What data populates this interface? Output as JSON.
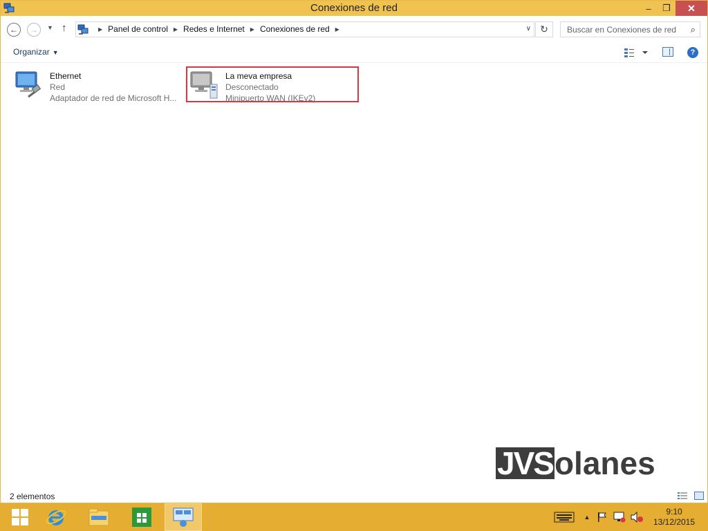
{
  "window": {
    "title": "Conexiones de red"
  },
  "address_bar": {
    "breadcrumbs": [
      "Panel de control",
      "Redes e Internet",
      "Conexiones de red"
    ]
  },
  "search": {
    "placeholder": "Buscar en Conexiones de red"
  },
  "command_bar": {
    "organize_label": "Organizar"
  },
  "items": [
    {
      "name": "Ethernet",
      "status": "Red",
      "device": "Adaptador de red de Microsoft H...",
      "icon": "ethernet-adapter-icon"
    },
    {
      "name": "La meva empresa",
      "status": "Desconectado",
      "device": "Minipuerto WAN (IKEv2)",
      "icon": "vpn-connection-icon",
      "highlighted": true,
      "highlight_color": "#d9363e"
    }
  ],
  "status_bar": {
    "item_count": "2 elementos"
  },
  "watermark": {
    "box_text": "JVS",
    "rest_text": "olanes"
  },
  "taskbar": {
    "apps": [
      "start-icon",
      "internet-explorer-icon",
      "file-explorer-icon",
      "store-icon",
      "network-connections-icon"
    ],
    "active_app": "network-connections-icon",
    "time": "9:10",
    "date": "13/12/2015"
  },
  "colors": {
    "titlebar": "#f0c350",
    "taskbar": "#e6ad33",
    "close_button": "#c75050",
    "link_text": "#1e395b"
  }
}
